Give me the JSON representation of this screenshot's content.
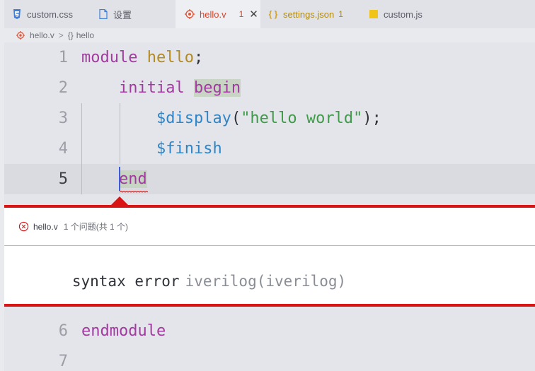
{
  "tabs": [
    {
      "label": "custom.css",
      "icon": "css-icon",
      "badge": "",
      "active": false,
      "modified": false
    },
    {
      "label": "设置",
      "icon": "file-icon",
      "badge": "",
      "active": false,
      "modified": false
    },
    {
      "label": "hello.v",
      "icon": "verilog-icon",
      "badge": "1",
      "active": true,
      "modified": false
    },
    {
      "label": "settings.json",
      "icon": "json-icon",
      "badge": "1",
      "active": false,
      "modified": true
    },
    {
      "label": "custom.js",
      "icon": "js-icon",
      "badge": "",
      "active": false,
      "modified": false
    }
  ],
  "tab_close_glyph": "✕",
  "breadcrumb": {
    "file": "hello.v",
    "separator": ">",
    "symbol_glyph": "{}",
    "symbol": "hello"
  },
  "code_lines": [
    {
      "n": "1",
      "parts": [
        [
          "module",
          "kw"
        ],
        [
          " ",
          "plain"
        ],
        [
          "hello",
          "mod"
        ],
        [
          ";",
          "plain"
        ]
      ]
    },
    {
      "n": "2",
      "parts": [
        [
          "    ",
          "plain"
        ],
        [
          "initial",
          "kw"
        ],
        [
          " ",
          "plain"
        ],
        [
          "begin",
          "kw hl"
        ]
      ]
    },
    {
      "n": "3",
      "parts": [
        [
          "        ",
          "plain"
        ],
        [
          "$display",
          "sys"
        ],
        [
          "(",
          "plain"
        ],
        [
          "\"hello world\"",
          "str"
        ],
        [
          ");",
          "plain"
        ]
      ]
    },
    {
      "n": "4",
      "parts": [
        [
          "        ",
          "plain"
        ],
        [
          "$finish",
          "sys"
        ]
      ]
    },
    {
      "n": "5",
      "parts": [
        [
          "    ",
          "plain"
        ],
        [
          "end",
          "kw hl"
        ]
      ]
    }
  ],
  "problem_peek": {
    "file": "hello.v",
    "count_text": "1 个问题(共 1 个)",
    "message": "syntax error",
    "source": "iverilog(iverilog)"
  },
  "code_lines_after": [
    {
      "n": "6",
      "parts": [
        [
          "endmodule",
          "kw"
        ]
      ]
    },
    {
      "n": "7",
      "parts": []
    }
  ],
  "colors": {
    "error": "#d91414",
    "keyword": "#a23aa1",
    "module_name": "#b38a1f",
    "system_task": "#2e86c8",
    "string": "#3f9b4a",
    "caret": "#3b5bdb"
  }
}
